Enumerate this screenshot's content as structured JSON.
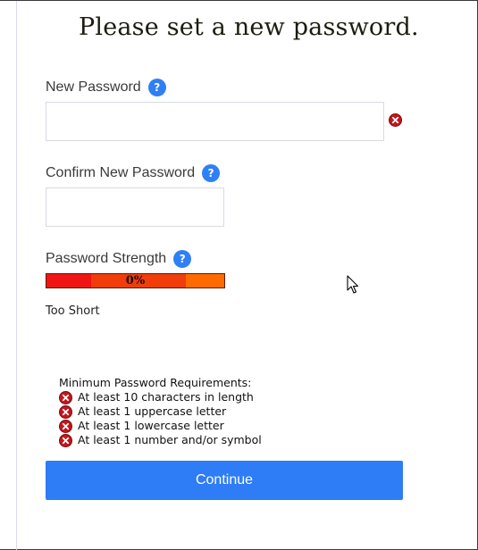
{
  "page": {
    "title": "Please set a new password."
  },
  "new_password": {
    "label": "New Password",
    "value": "",
    "placeholder": "",
    "help_icon": "help-icon",
    "error_icon": "error-icon"
  },
  "confirm_password": {
    "label": "Confirm New Password",
    "value": "",
    "placeholder": "",
    "help_icon": "help-icon"
  },
  "strength": {
    "label": "Password Strength",
    "value_text": "0%",
    "status": "Too Short",
    "segment_colors": [
      "#f01515",
      "#f03d0a",
      "#ff6a00"
    ]
  },
  "requirements": {
    "title": "Minimum Password Requirements:",
    "items": [
      "At least 10 characters in length",
      "At least 1 uppercase letter",
      "At least 1 lowercase letter",
      "At least 1 number and/or symbol"
    ],
    "icon": "error-icon"
  },
  "actions": {
    "continue_label": "Continue"
  },
  "colors": {
    "accent": "#2e7cf6",
    "error": "#c4161c"
  }
}
